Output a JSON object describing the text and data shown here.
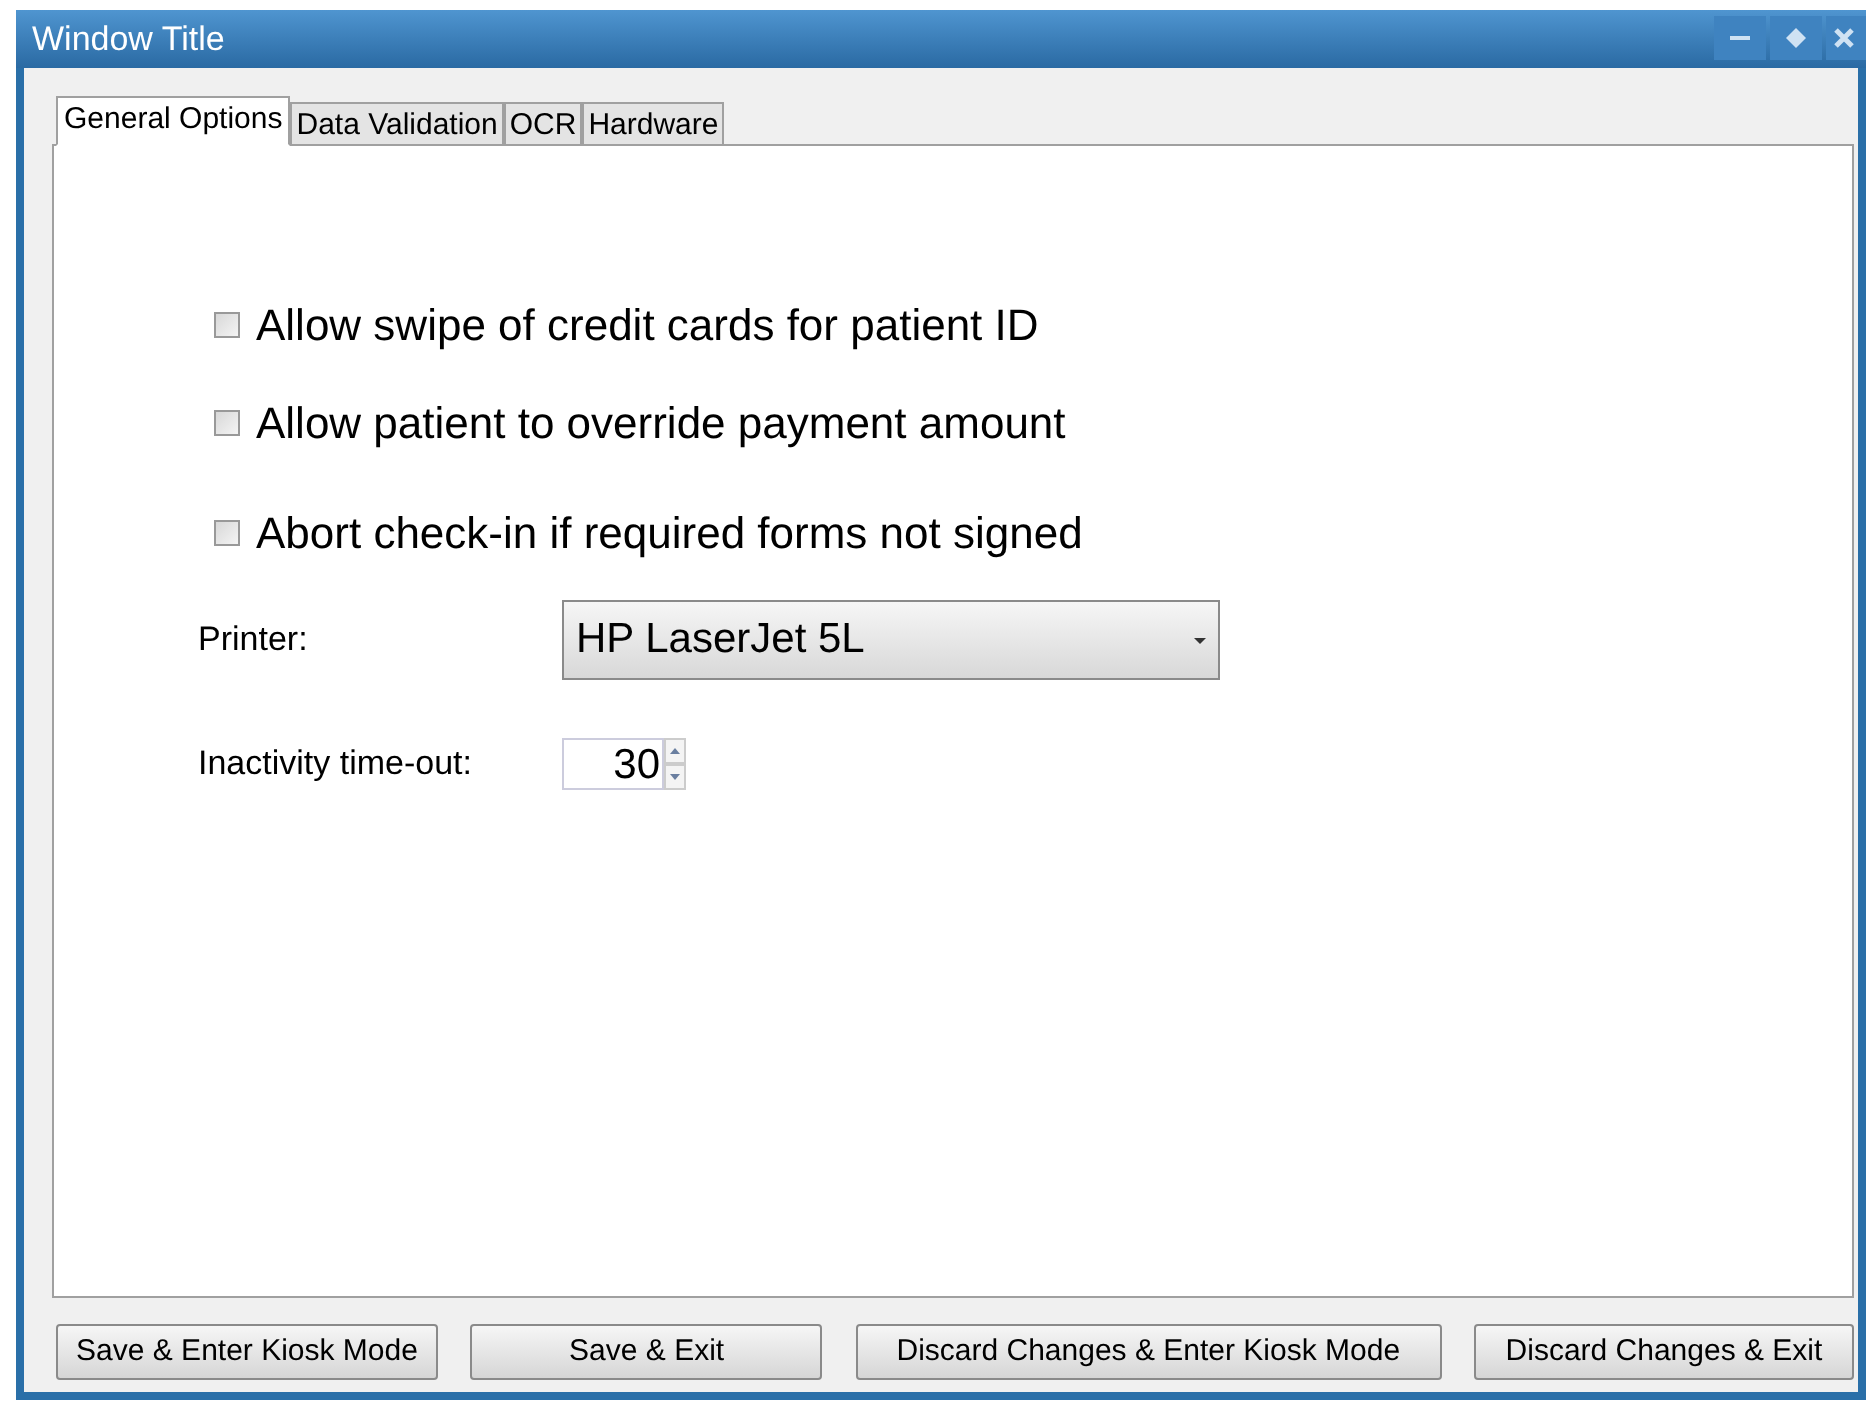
{
  "window": {
    "title": "Window Title"
  },
  "tabs": [
    {
      "label": "General Options",
      "selected": true
    },
    {
      "label": "Data Validation",
      "selected": false
    },
    {
      "label": "OCR",
      "selected": false
    },
    {
      "label": "Hardware",
      "selected": false
    }
  ],
  "options": [
    {
      "label": "Allow swipe of credit cards for patient ID",
      "checked": false
    },
    {
      "label": "Allow patient to override payment amount",
      "checked": false
    },
    {
      "label": "Abort check-in if required forms not signed",
      "checked": false
    }
  ],
  "printer": {
    "label": "Printer:",
    "value": "HP LaserJet 5L"
  },
  "timeout": {
    "label": "Inactivity time-out:",
    "value": "30"
  },
  "buttons": [
    "Save & Enter Kiosk Mode",
    "Save & Exit",
    "Discard Changes & Enter Kiosk Mode",
    "Discard Changes & Exit"
  ]
}
